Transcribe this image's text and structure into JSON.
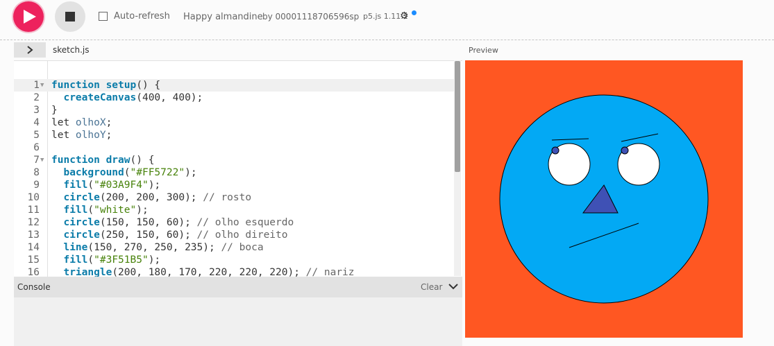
{
  "toolbar": {
    "play_icon": "play-icon",
    "stop_icon": "stop-icon",
    "auto_refresh_label": "Auto-refresh",
    "project_name": "Happy almandine",
    "project_owner": "by 00001118706596sp",
    "version": "p5.js 1.11.1",
    "settings_icon": "gear-icon"
  },
  "editor": {
    "file_name": "sketch.js",
    "preview_label": "Preview",
    "lines": [
      "function setup() {",
      "  createCanvas(400, 400);",
      "}",
      "let olhoX;",
      "let olhoY;",
      "",
      "function draw() {",
      "  background(\"#FF5722\");",
      "  fill(\"#03A9F4\");",
      "  circle(200, 200, 300); // rosto",
      "  fill(\"white\");",
      "  circle(150, 150, 60); // olho esquerdo",
      "  circle(250, 150, 60); // olho direito",
      "  line(150, 270, 250, 235); // boca",
      "  fill(\"#3F51B5\");",
      "  triangle(200, 180, 170, 220, 220, 220); // nariz"
    ],
    "line_numbers": [
      "1",
      "2",
      "3",
      "4",
      "5",
      "6",
      "7",
      "8",
      "9",
      "10",
      "11",
      "12",
      "13",
      "14",
      "15",
      "16"
    ]
  },
  "console": {
    "title": "Console",
    "clear_label": "Clear"
  },
  "colors": {
    "accent": "#ed225d",
    "canvas_background": "#FF5722",
    "face": "#03A9F4",
    "nose": "#3F51B5",
    "eye": "#ffffff"
  }
}
